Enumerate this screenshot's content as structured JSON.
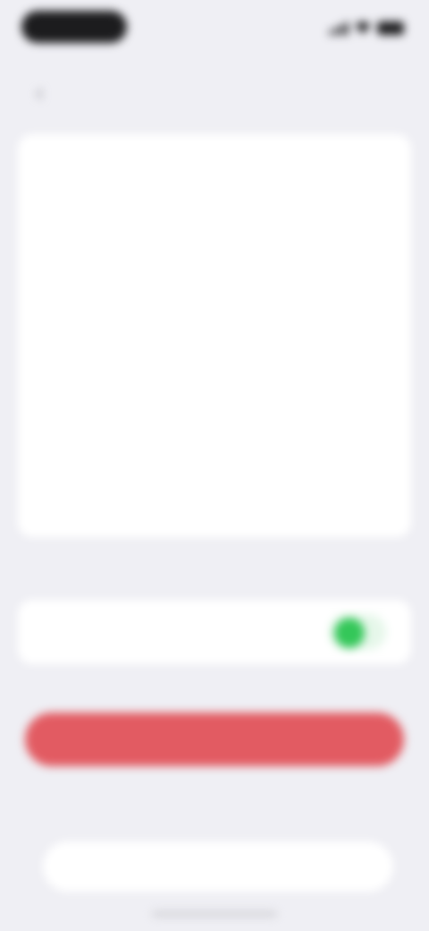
{
  "status_bar": {
    "time": "",
    "signal_icon": "signal-icon",
    "wifi_icon": "wifi-icon",
    "battery_icon": "battery-icon"
  },
  "nav": {
    "back_glyph": "‹",
    "title": ""
  },
  "settings_rows": [
    {
      "label": "",
      "value": ""
    },
    {
      "label": "",
      "value": ""
    },
    {
      "label": "",
      "value": ""
    },
    {
      "label": "",
      "value": ""
    },
    {
      "label": "",
      "value": ""
    },
    {
      "label": "",
      "value": ""
    },
    {
      "label": "",
      "value": ""
    }
  ],
  "extra_row": {
    "label": "",
    "value": ""
  },
  "toggle_row": {
    "label": "",
    "state": "on"
  },
  "danger_button": {
    "label": ""
  },
  "tab_bar": {
    "label": ""
  },
  "colors": {
    "accent_green": "#34c759",
    "danger_red": "#e25b62",
    "background": "#efeff4"
  }
}
